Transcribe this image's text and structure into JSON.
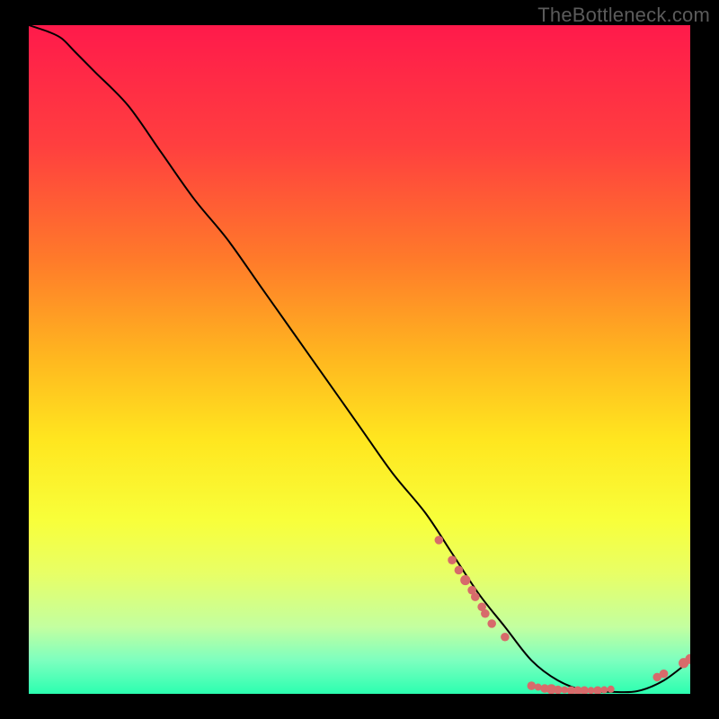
{
  "watermark": "TheBottleneck.com",
  "chart_data": {
    "type": "line",
    "title": "",
    "xlabel": "",
    "ylabel": "",
    "xlim": [
      0,
      100
    ],
    "ylim": [
      0,
      100
    ],
    "grid": false,
    "legend": false,
    "series": [
      {
        "name": "bottleneck-curve",
        "x": [
          0,
          3,
          5,
          7,
          10,
          15,
          20,
          25,
          30,
          35,
          40,
          45,
          50,
          55,
          60,
          64,
          68,
          72,
          76,
          80,
          84,
          88,
          92,
          96,
          100
        ],
        "y": [
          100,
          99,
          98,
          96,
          93,
          88,
          81,
          74,
          68,
          61,
          54,
          47,
          40,
          33,
          27,
          21,
          15,
          10,
          5,
          2,
          0.5,
          0.3,
          0.4,
          2,
          5
        ]
      }
    ],
    "markers": [
      {
        "x": 62,
        "y": 23,
        "r": 1.2
      },
      {
        "x": 64,
        "y": 20,
        "r": 1.2
      },
      {
        "x": 65,
        "y": 18.5,
        "r": 1.2
      },
      {
        "x": 66,
        "y": 17,
        "r": 1.4
      },
      {
        "x": 67,
        "y": 15.5,
        "r": 1.2
      },
      {
        "x": 67.5,
        "y": 14.5,
        "r": 1.2
      },
      {
        "x": 68.5,
        "y": 13,
        "r": 1.2
      },
      {
        "x": 69,
        "y": 12,
        "r": 1.2
      },
      {
        "x": 70,
        "y": 10.5,
        "r": 1.2
      },
      {
        "x": 72,
        "y": 8.5,
        "r": 1.2
      },
      {
        "x": 76,
        "y": 1.2,
        "r": 1.2
      },
      {
        "x": 77,
        "y": 1.0,
        "r": 1.0
      },
      {
        "x": 78,
        "y": 0.8,
        "r": 1.2
      },
      {
        "x": 79,
        "y": 0.7,
        "r": 1.4
      },
      {
        "x": 80,
        "y": 0.6,
        "r": 1.2
      },
      {
        "x": 81,
        "y": 0.6,
        "r": 1.0
      },
      {
        "x": 82,
        "y": 0.5,
        "r": 1.2
      },
      {
        "x": 83,
        "y": 0.5,
        "r": 1.2
      },
      {
        "x": 84,
        "y": 0.5,
        "r": 1.2
      },
      {
        "x": 85,
        "y": 0.5,
        "r": 1.0
      },
      {
        "x": 86,
        "y": 0.5,
        "r": 1.2
      },
      {
        "x": 87,
        "y": 0.6,
        "r": 1.0
      },
      {
        "x": 88,
        "y": 0.7,
        "r": 1.0
      },
      {
        "x": 95,
        "y": 2.5,
        "r": 1.2
      },
      {
        "x": 96,
        "y": 3.0,
        "r": 1.2
      },
      {
        "x": 99,
        "y": 4.6,
        "r": 1.4
      },
      {
        "x": 100,
        "y": 5.2,
        "r": 1.4
      }
    ],
    "gradient_stops": [
      {
        "offset": 0,
        "color": "#ff1a4b"
      },
      {
        "offset": 18,
        "color": "#ff3f3f"
      },
      {
        "offset": 35,
        "color": "#ff7a2a"
      },
      {
        "offset": 50,
        "color": "#ffb81f"
      },
      {
        "offset": 62,
        "color": "#ffe61f"
      },
      {
        "offset": 74,
        "color": "#f8ff3a"
      },
      {
        "offset": 82,
        "color": "#e8ff66"
      },
      {
        "offset": 90,
        "color": "#c3ffa0"
      },
      {
        "offset": 95,
        "color": "#7dffbf"
      },
      {
        "offset": 100,
        "color": "#2bffb0"
      }
    ],
    "curve_color": "#000000",
    "marker_color": "#d76b6b"
  }
}
